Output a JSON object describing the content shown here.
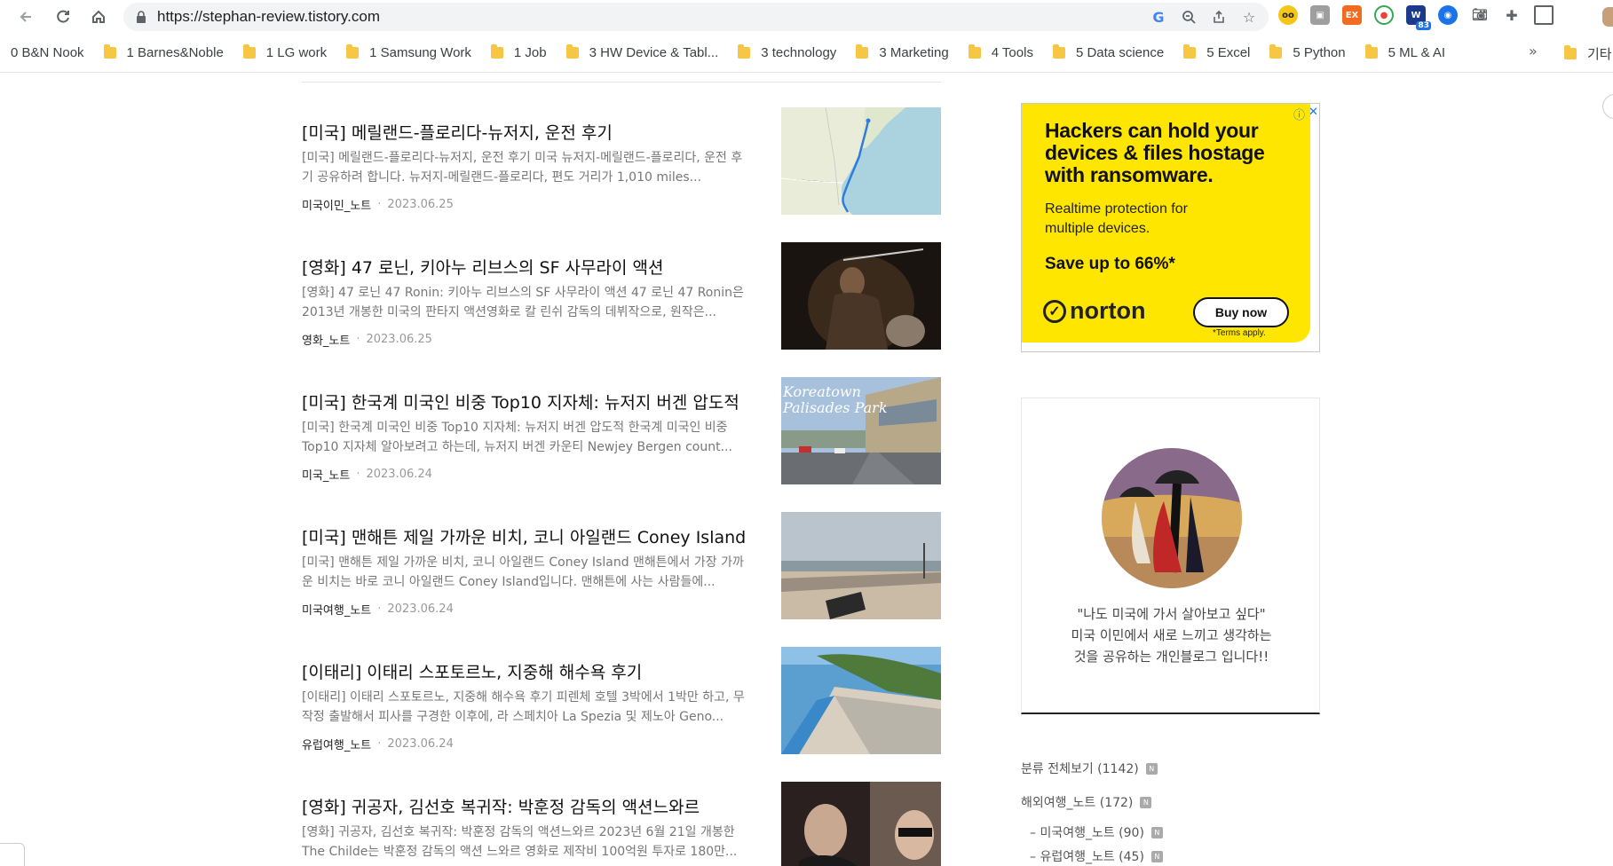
{
  "browser": {
    "url": "https://stephan-review.tistory.com",
    "bookmarks": [
      "0 B&N Nook",
      "1 Barnes&Noble",
      "1 LG work",
      "1 Samsung Work",
      "1 Job",
      "3 HW Device & Tabl...",
      "3 technology",
      "3 Marketing",
      "4 Tools",
      "5 Data science",
      "5 Excel",
      "5 Python",
      "5 ML & AI"
    ],
    "bookmark_more": "»",
    "bookmark_last": "기타",
    "ext_badge": "83"
  },
  "posts": [
    {
      "title": "[미국] 메릴랜드-플로리다-뉴저지, 운전 후기",
      "excerpt": "[미국] 메릴랜드-플로리다-뉴저지, 운전 후기 미국 뉴저지-메릴랜드-플로리다, 운전 후기 공유하려 합니다. 뉴저지-메릴랜드-플로리다, 편도 거리가 1,010 miles...",
      "category": "미국이민_노트",
      "date": "2023.06.25"
    },
    {
      "title": "[영화] 47 로닌, 키아누 리브스의 SF 사무라이 액션",
      "excerpt": "[영화] 47 로닌 47 Ronin: 키아누 리브스의 SF 사무라이 액션 47 로닌 47 Ronin은 2013년 개봉한 미국의 판타지 액션영화로 칼 린쉬 감독의 데뷔작으로, 원작은...",
      "category": "영화_노트",
      "date": "2023.06.25"
    },
    {
      "title": "[미국] 한국계 미국인 비중 Top10 지자체: 뉴저지 버겐 압도적",
      "excerpt": "[미국] 한국계 미국인 비중 Top10 지자체: 뉴저지 버겐 압도적 한국계 미국인 비중 Top10 지자체 알아보려고 하는데, 뉴저지 버겐 카운티 Newjey Bergen count...",
      "category": "미국_노트",
      "date": "2023.06.24",
      "thumb_text": [
        "Koreatown",
        "Palisades Park"
      ]
    },
    {
      "title": "[미국] 맨해튼 제일 가까운 비치, 코니 아일랜드 Coney Island",
      "excerpt": "[미국] 맨해튼 제일 가까운 비치, 코니 아일랜드 Coney Island 맨해튼에서 가장 가까운 비치는 바로 코니 아일랜드 Coney Island입니다. 맨해튼에 사는 사람들에...",
      "category": "미국여행_노트",
      "date": "2023.06.24"
    },
    {
      "title": "[이태리] 이태리 스포토르노, 지중해 해수욕 후기",
      "excerpt": "[이태리] 이태리 스포토르노, 지중해 해수욕 후기 피렌체 호텔 3박에서 1박만 하고, 무작정 출발해서 피사를 구경한 이후에, 라 스페치아 La Spezia 및 제노아 Geno...",
      "category": "유럽여행_노트",
      "date": "2023.06.24"
    },
    {
      "title": "[영화] 귀공자, 김선호 복귀작: 박훈정 감독의 액션느와르",
      "excerpt": "[영화] 귀공자, 김선호 복귀작: 박훈정 감독의 액션느와르 2023년 6월 21일 개봉한 The Childe는 박훈정 감독의 액션 느와르 영화로 제작비 100억원 투자로 180만...",
      "category": "",
      "date": ""
    }
  ],
  "ad": {
    "headline": [
      "Hackers can hold your",
      "devices & files hostage",
      "with ransomware."
    ],
    "sub": [
      "Realtime protection for",
      "multiple devices."
    ],
    "save": "Save up to 66%*",
    "brand": "norton",
    "cta": "Buy now",
    "terms": "*Terms apply.",
    "colors": {
      "background": "#fee600"
    }
  },
  "profile": {
    "lines": [
      "\"나도 미국에 가서 살아보고 싶다\"",
      "미국 이민에서 새로 느끼고 생각하는",
      "것을 공유하는 개인블로그 입니다!!"
    ]
  },
  "categories": [
    {
      "label": "분류 전체보기 (1142)",
      "indent": 0
    },
    {
      "label": "해외여행_노트 (172)",
      "indent": 0
    },
    {
      "label": "– 미국여행_노트 (90)",
      "indent": 1
    },
    {
      "label": "– 유럽여행_노트 (45)",
      "indent": 1
    }
  ]
}
